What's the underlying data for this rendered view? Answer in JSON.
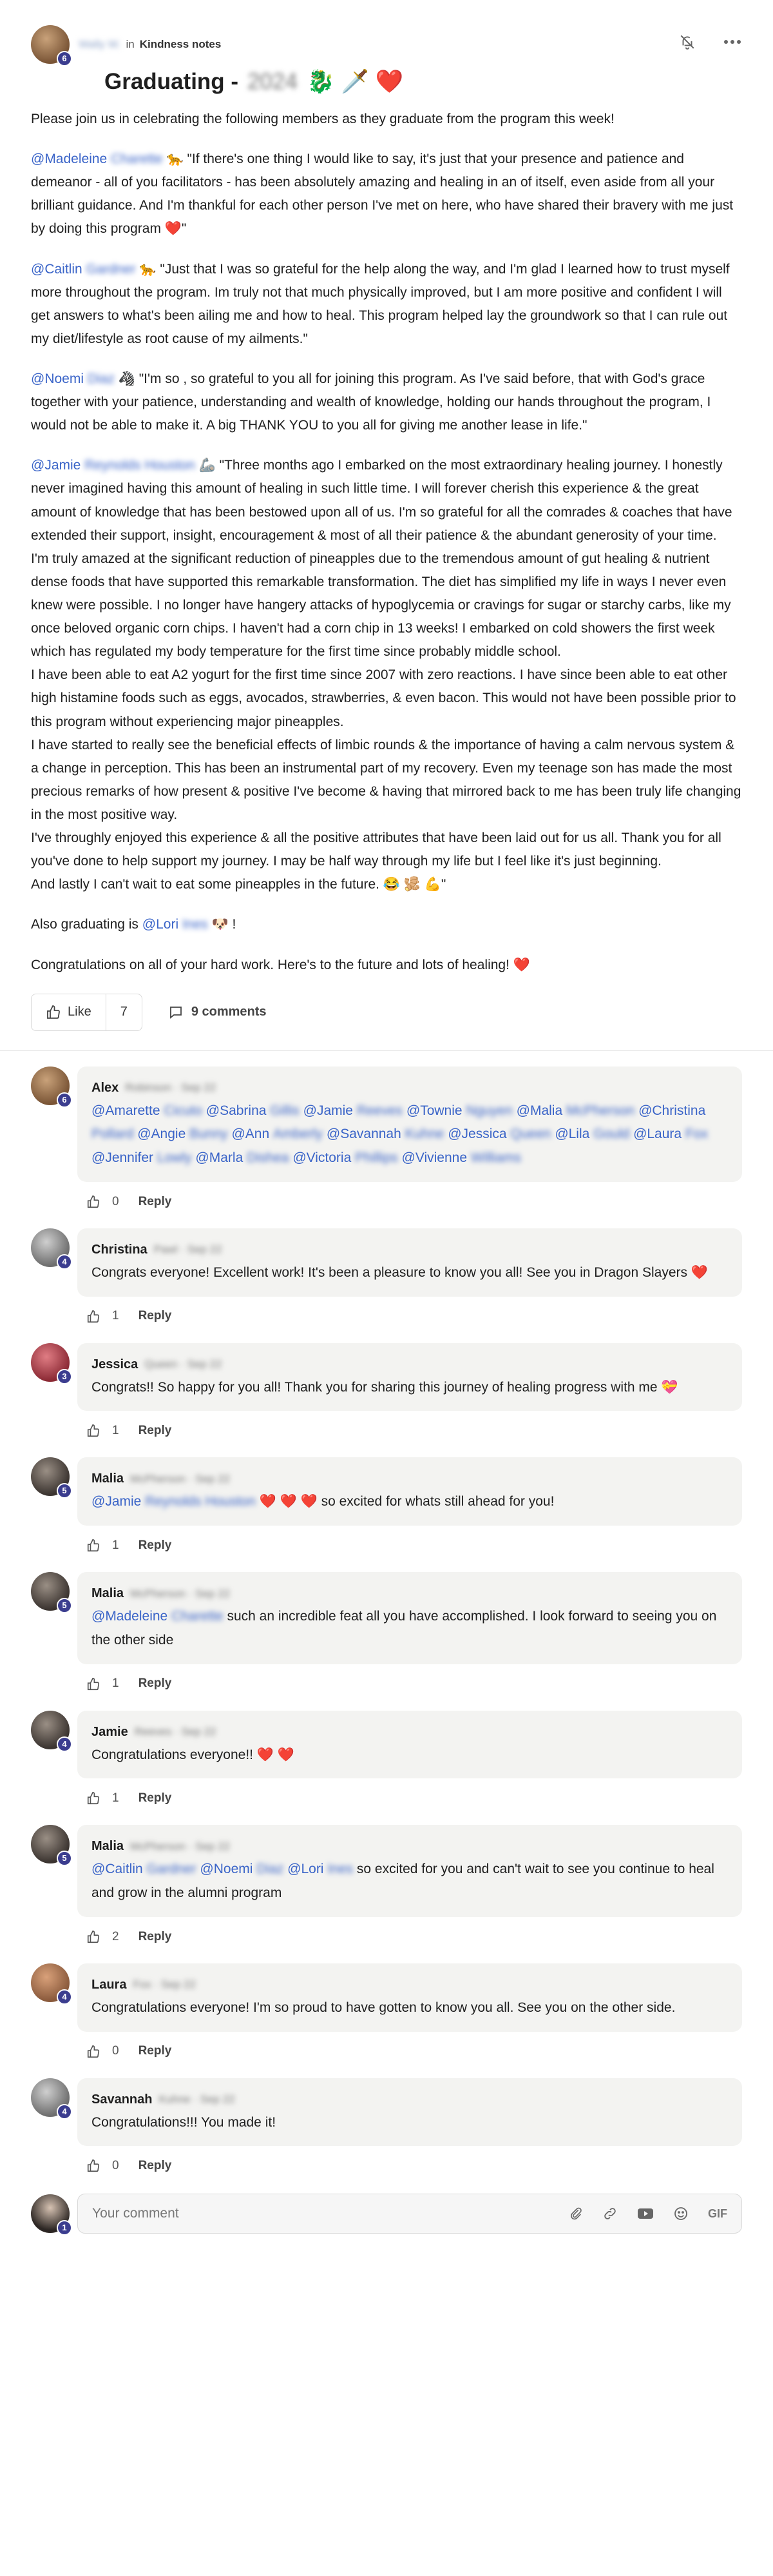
{
  "post": {
    "author_level": "6",
    "author_name_blurred": "Wally W.",
    "in_word": "in",
    "group": "Kindness notes",
    "title": "Graduating -",
    "title_blurred": "2024",
    "title_emoji": "🐉 🗡️ ❤️",
    "intro": "Please join us in celebrating the following members as they graduate from the program this week!",
    "program_blurred": "",
    "messages": [
      {
        "mention": "@Madeleine",
        "mention_blur": "Charette",
        "emoji": "🐆",
        "text": "\"If there's one thing I would like to say, it's just that your presence and patience and demeanor - all of you facilitators - has been absolutely amazing and healing in an of itself, even aside from all your brilliant guidance. And I'm thankful for each other person I've met on here, who have shared their bravery with me just by doing this program ❤️\""
      },
      {
        "mention": "@Caitlin",
        "mention_blur": "Gardner",
        "emoji": "🐆",
        "text": "\"Just that I was so grateful for the help along the way, and I'm glad I learned how to trust myself more throughout the program. Im truly not that much physically improved, but I am more positive and confident I will get answers to what's been ailing me and how to heal. This program helped lay the groundwork so that I can rule out my diet/lifestyle as root cause of my ailments.\""
      },
      {
        "mention": "@Noemi",
        "mention_blur": "Diaz",
        "emoji": "🦓",
        "text": "\"I'm so , so grateful to you all for joining this program. As I've said before, that with God's grace together with your patience, understanding and wealth of knowledge, holding our hands throughout the program, I would not be able to make it. A big THANK YOU to you all for giving me another lease in life.\""
      }
    ],
    "jamie": {
      "mention": "@Jamie",
      "mention_blur": "Reynolds Houston",
      "emoji": "🦾",
      "lines": [
        "\"Three months ago I embarked on the most extraordinary healing journey. I honestly never imagined having this amount of healing in such little time. I will forever cherish this experience & the great amount of knowledge that has been bestowed upon all of us. I'm so grateful for all the comrades & coaches that have extended their support, insight, encouragement & most of all their patience & the abundant generosity of your time.",
        "I'm truly amazed at the significant reduction of pineapples due to the tremendous amount of gut healing & nutrient dense foods that have supported this remarkable transformation. The diet has simplified my life in ways I never even knew were possible. I no longer have hangery attacks of hypoglycemia or cravings for sugar or starchy carbs, like my once beloved organic corn chips. I haven't had a corn chip in 13 weeks! I embarked on cold showers the first week which has regulated my body temperature for the first time since probably middle school.",
        "I have been able to eat A2 yogurt for the first time since 2007 with zero reactions. I have since been able to eat other high histamine foods such as eggs, avocados, strawberries, & even bacon. This would not have been possible prior to this program without experiencing major pineapples.",
        "I have started to really see the beneficial effects of limbic rounds & the importance of having a calm nervous system & a change in perception. This has been an instrumental part of my recovery. Even my teenage son has made the most precious remarks of how present & positive I've become & having that mirrored back to me has been truly life changing in the most positive way.",
        "I've throughly enjoyed this experience & all the positive attributes that have been laid out for us all. Thank you for all you've done to help support my journey. I may be half way through my life but I feel like it's just beginning.",
        "And lastly I can't wait to eat some pineapples in the future. 😂 🫚 💪\""
      ]
    },
    "also": {
      "text": "Also graduating is",
      "mention": "@Lori",
      "mention_blur": "Ines",
      "emoji": "🐶 !"
    },
    "closing": "Congratulations on all of your hard work. Here's to the future and lots of healing! ❤️",
    "like_label": "Like",
    "like_count": "7",
    "comments_label": "9 comments"
  },
  "comments": [
    {
      "name": "Alex",
      "name_blur": "Robinson · Sep 22",
      "level": "6",
      "avatar": "av-brown",
      "mentions": [
        [
          "@Amarette",
          "Cicuto"
        ],
        [
          "@Sabrina",
          "Gillis"
        ],
        [
          "@Jamie",
          "Reeves"
        ],
        [
          "@Townie",
          "Nguyen"
        ],
        [
          "@Malia",
          "McPherson"
        ],
        [
          "@Christina",
          "Pollard"
        ],
        [
          "@Angie",
          "Bunny"
        ],
        [
          "@Ann",
          "Amberly"
        ],
        [
          "@Savannah",
          "Kuhne"
        ],
        [
          "@Jessica",
          "Queen"
        ],
        [
          "@Lila",
          "Gould"
        ],
        [
          "@Laura",
          "Fox"
        ],
        [
          "@Jennifer",
          "Lowly"
        ],
        [
          "@Marla",
          "Dishea"
        ],
        [
          "@Victoria",
          "Phillips"
        ],
        [
          "@Vivienne",
          "Williams"
        ]
      ],
      "likes": "0"
    },
    {
      "name": "Christina",
      "name_blur": "Pawl · Sep 22",
      "level": "4",
      "avatar": "av-grey",
      "text": "Congrats everyone! Excellent work! It's been a pleasure to know you all! See you in Dragon Slayers ❤️",
      "likes": "1"
    },
    {
      "name": "Jessica",
      "name_blur": "Queen · Sep 22",
      "level": "3",
      "avatar": "av-red",
      "text": "Congrats!! So happy for you all! Thank you for sharing this journey of healing progress with me 💝",
      "likes": "1"
    },
    {
      "name": "Malia",
      "name_blur": "McPherson · Sep 22",
      "level": "5",
      "avatar": "av-dark",
      "mention": "@Jamie",
      "mention_blur": "Reynolds Houston",
      "text": "❤️ ❤️ ❤️  so excited for whats still ahead for you!",
      "likes": "1"
    },
    {
      "name": "Malia",
      "name_blur": "McPherson · Sep 22",
      "level": "5",
      "avatar": "av-dark",
      "mention": "@Madeleine",
      "mention_blur": "Charette",
      "text": "such an incredible feat all you have accomplished. I look forward to seeing you on the other side",
      "likes": "1"
    },
    {
      "name": "Jamie",
      "name_blur": "Reeves · Sep 22",
      "level": "4",
      "avatar": "av-dark",
      "text": "Congratulations everyone!! ❤️ ❤️",
      "likes": "1"
    },
    {
      "name": "Malia",
      "name_blur": "McPherson · Sep 22",
      "level": "5",
      "avatar": "av-dark",
      "mentions3": [
        [
          "@Caitlin",
          "Gardner"
        ],
        [
          "@Noemi",
          "Diaz"
        ],
        [
          "@Lori",
          "Ines"
        ]
      ],
      "text": "so excited for you and can't wait to see you continue to heal and grow in the alumni program",
      "likes": "2"
    },
    {
      "name": "Laura",
      "name_blur": "Fox · Sep 22",
      "level": "4",
      "avatar": "av-tan",
      "text": "Congratulations everyone! I'm so proud to have gotten to know you all. See you on the other side.",
      "likes": "0"
    },
    {
      "name": "Savannah",
      "name_blur": "Kuhne · Sep 22",
      "level": "4",
      "avatar": "av-grey",
      "text": "Congratulations!!! You made it!",
      "likes": "0"
    }
  ],
  "reply_label": "Reply",
  "composer": {
    "level": "1",
    "placeholder": "Your comment",
    "gif_label": "GIF"
  },
  "icons": [
    "bell-off-icon",
    "more-icon",
    "thumbs-up-icon",
    "comment-icon",
    "paperclip-icon",
    "link-icon",
    "video-icon",
    "emoji-icon"
  ]
}
